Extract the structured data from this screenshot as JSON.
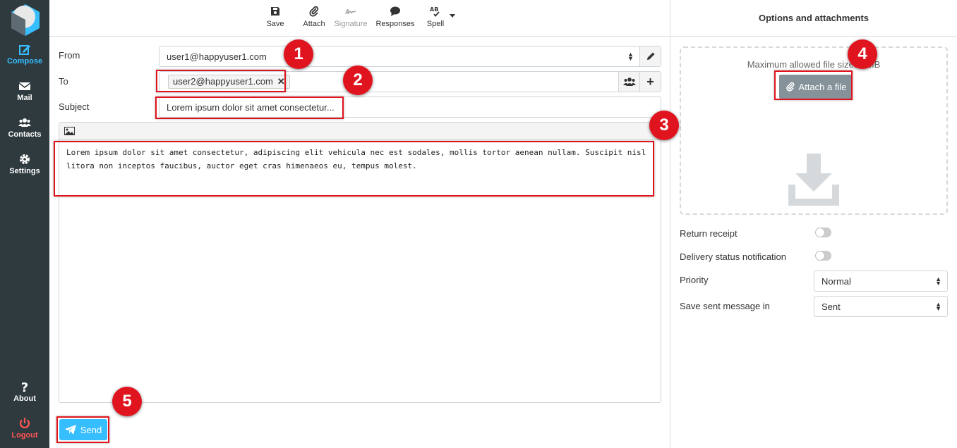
{
  "sidebar": {
    "items": [
      {
        "label": "Compose"
      },
      {
        "label": "Mail"
      },
      {
        "label": "Contacts"
      },
      {
        "label": "Settings"
      },
      {
        "label": "About"
      },
      {
        "label": "Logout"
      }
    ]
  },
  "toolbar": {
    "save_label": "Save",
    "attach_label": "Attach",
    "signature_label": "Signature",
    "responses_label": "Responses",
    "spell_label": "Spell"
  },
  "compose": {
    "from_label": "From",
    "from_value": "user1@happyuser1.com",
    "to_label": "To",
    "to_recipient": "user2@happyuser1.com",
    "subject_label": "Subject",
    "subject_value": "Lorem ipsum dolor sit amet consectetur...",
    "body_text": "Lorem ipsum dolor sit amet consectetur, adipiscing elit vehicula nec est sodales, mollis tortor aenean nullam. Suscipit nisl litora non inceptos faucibus, auctor eget cras himenaeos eu, tempus molest.",
    "send_label": "Send"
  },
  "options": {
    "header": "Options and attachments",
    "max_size_text": "Maximum allowed file size: 5 MB",
    "attach_file_label": "Attach a file",
    "return_receipt_label": "Return receipt",
    "return_receipt_on": false,
    "dsn_label": "Delivery status notification",
    "dsn_on": false,
    "priority_label": "Priority",
    "priority_value": "Normal",
    "save_sent_label": "Save sent message in",
    "save_sent_value": "Sent"
  },
  "callouts": [
    "1",
    "2",
    "3",
    "4",
    "5"
  ],
  "colors": {
    "sidebar_bg": "#2f3a3f",
    "accent": "#37beff",
    "logout": "#ff5552",
    "highlight": "#e0141e"
  }
}
